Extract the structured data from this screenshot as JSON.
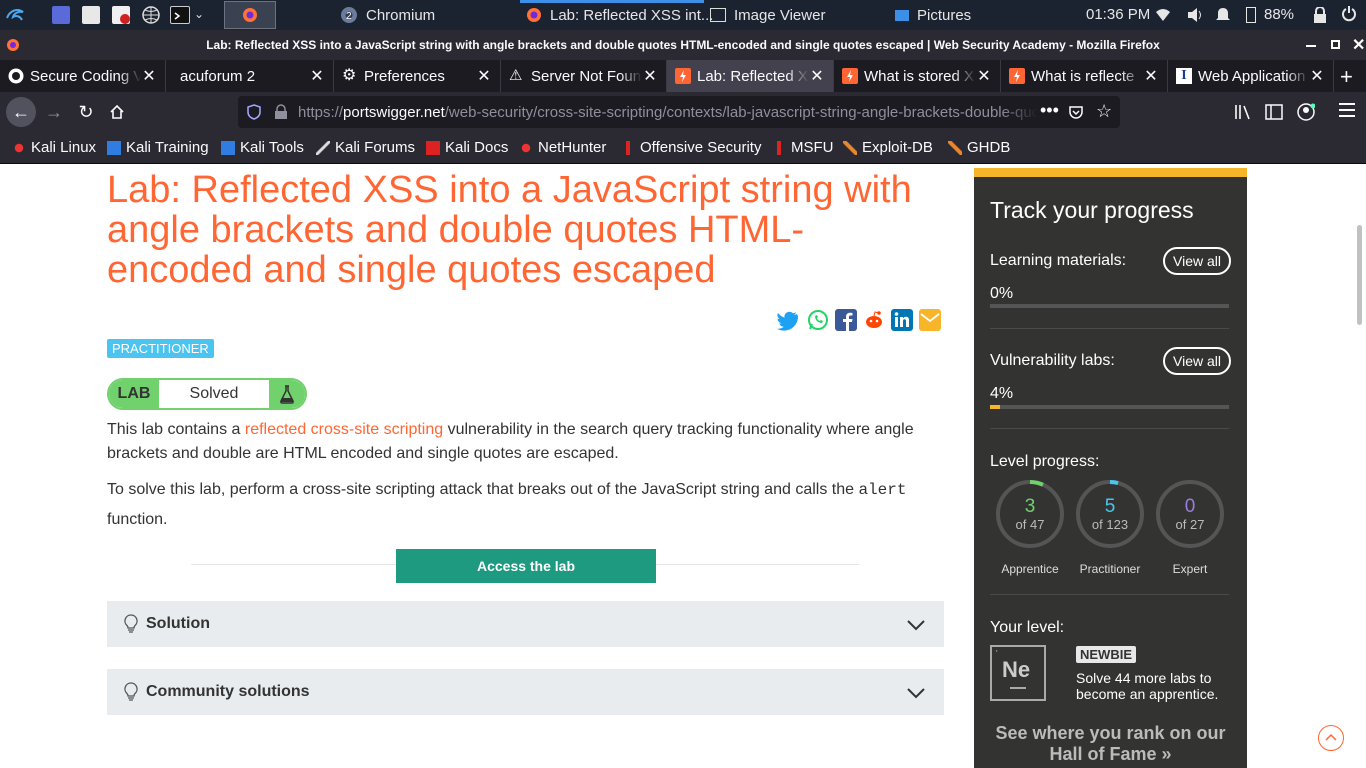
{
  "taskbar": {
    "windows": [
      {
        "label": "Chromium",
        "badge": "2"
      },
      {
        "label": "Lab: Reflected XSS int..."
      },
      {
        "label": "Image Viewer"
      },
      {
        "label": "Pictures"
      }
    ],
    "clock": "01:36 PM",
    "battery": "88%"
  },
  "browser": {
    "window_title": "Lab: Reflected XSS into a JavaScript string with angle brackets and double quotes HTML-encoded and single quotes escaped | Web Security Academy - Mozilla Firefox",
    "tabs": [
      {
        "label": "Secure Coding V",
        "icon": "github-icon"
      },
      {
        "label": "acuforum 2",
        "icon": "none"
      },
      {
        "label": "Preferences",
        "icon": "gear-icon"
      },
      {
        "label": "Server Not Foun",
        "icon": "warning-icon"
      },
      {
        "label": "Lab: Reflected X",
        "icon": "portswigger-icon"
      },
      {
        "label": "What is stored X",
        "icon": "portswigger-icon"
      },
      {
        "label": "What is reflecte",
        "icon": "portswigger-icon"
      },
      {
        "label": "Web Application",
        "icon": "letter-i-icon"
      }
    ],
    "url_domain": "portswigger.net",
    "url_prefix": "https://",
    "url_path": "/web-security/cross-site-scripting/contexts/lab-javascript-string-angle-brackets-double-quotes-encoded-single-quotes-escaped",
    "bookmarks": [
      "Kali Linux",
      "Kali Training",
      "Kali Tools",
      "Kali Forums",
      "Kali Docs",
      "NetHunter",
      "Offensive Security",
      "MSFU",
      "Exploit-DB",
      "GHDB"
    ]
  },
  "page": {
    "title": "Lab: Reflected XSS into a JavaScript string with angle brackets and double quotes HTML-encoded and single quotes escaped",
    "level_badge": "PRACTITIONER",
    "lab_tag": "LAB",
    "lab_state": "Solved",
    "para1_before": "This lab contains a ",
    "para1_link": "reflected cross-site scripting",
    "para1_after": " vulnerability in the search query tracking functionality where angle brackets and double are HTML encoded and single quotes are escaped.",
    "para2_before": "To solve this lab, perform a cross-site scripting attack that breaks out of the JavaScript string and calls the ",
    "para2_code": "alert",
    "para2_after": " function.",
    "access_button": "Access the lab",
    "accordions": [
      "Solution",
      "Community solutions"
    ]
  },
  "sidebar": {
    "title": "Track your progress",
    "learning_label": "Learning materials:",
    "learning_pct": "0%",
    "learning_progress": 0,
    "labs_label": "Vulnerability labs:",
    "labs_pct": "4%",
    "labs_progress": 0.04,
    "view_all": "View all",
    "level_progress_label": "Level progress:",
    "levels": [
      {
        "num": "3",
        "of": "of 47",
        "caption": "Apprentice",
        "color": "#70d16d"
      },
      {
        "num": "5",
        "of": "of 123",
        "caption": "Practitioner",
        "color": "#4cc4f0"
      },
      {
        "num": "0",
        "of": "of 27",
        "caption": "Expert",
        "color": "#9b7de0"
      }
    ],
    "your_level_label": "Your level:",
    "level_symbol": "Ne",
    "level_name": "NEWBIE",
    "level_desc": "Solve 44 more labs to become an apprentice.",
    "hall_link": "See where you rank on our Hall of Fame »"
  }
}
